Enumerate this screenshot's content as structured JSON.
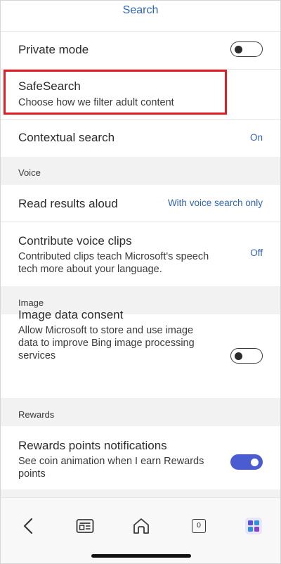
{
  "header": {
    "title": "Search"
  },
  "rows": {
    "private_mode": {
      "label": "Private mode",
      "toggle": "off"
    },
    "safesearch": {
      "label": "SafeSearch",
      "sub": "Choose how we filter adult content"
    },
    "contextual": {
      "label": "Contextual search",
      "value": "On"
    },
    "read_aloud": {
      "label": "Read results aloud",
      "value": "With voice search only"
    },
    "voice_clips": {
      "label": "Contribute voice clips",
      "sub1": "Contributed clips teach Microsoft's speech",
      "sub2": "tech more about your language.",
      "value": "Off"
    },
    "image_consent": {
      "label": "Image data consent",
      "sub1": "Allow Microsoft to store and use image",
      "sub2": "data to improve Bing image processing",
      "sub3": "services",
      "toggle": "off"
    },
    "rewards_notif": {
      "label": "Rewards points notifications",
      "sub1": "See coin animation when I earn Rewards",
      "sub2": "points",
      "toggle": "on"
    }
  },
  "sections": {
    "voice": "Voice",
    "image": "Image",
    "rewards": "Rewards"
  },
  "bottom_nav": {
    "tab_count": "0"
  },
  "colors": {
    "accent": "#2f64b5",
    "toggle_on": "#4b5cd1",
    "highlight": "#e31b23",
    "section_bg": "#f2f2f2"
  },
  "icons": [
    "back-icon",
    "news-icon",
    "home-icon",
    "tabs-icon",
    "apps-grid-icon"
  ]
}
